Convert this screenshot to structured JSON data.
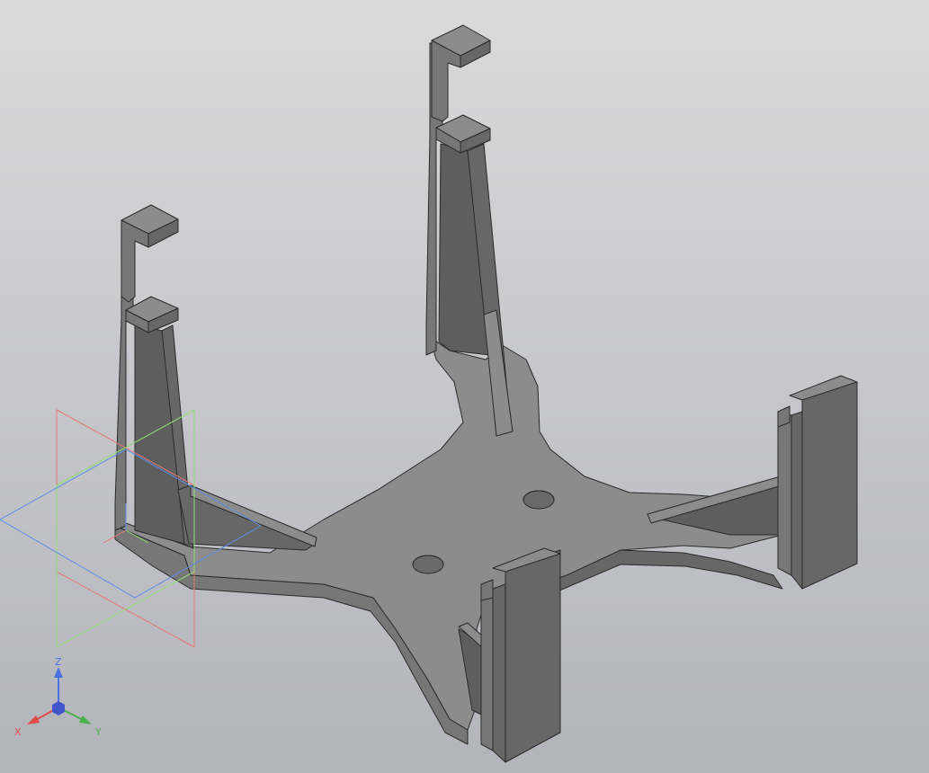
{
  "viewport": {
    "background_top": "#dadada",
    "background_bottom": "#b3b4bb"
  },
  "model": {
    "face_top": "#8c8c8c",
    "face_left": "#777777",
    "face_right": "#676767",
    "face_inner": "#5e5e5e",
    "edge_color": "#2b2b2b",
    "hole_color": "#6a6a6a"
  },
  "origin_planes": {
    "xy_color": "#5b8fe6",
    "zx_color": "#e67777",
    "yz_color": "#8fe070"
  },
  "triad": {
    "x_label": "X",
    "y_label": "Y",
    "z_label": "Z",
    "x_color": "#e24a4a",
    "y_color": "#4bb04b",
    "z_color": "#4a74e2",
    "origin_color": "#4455cc"
  }
}
